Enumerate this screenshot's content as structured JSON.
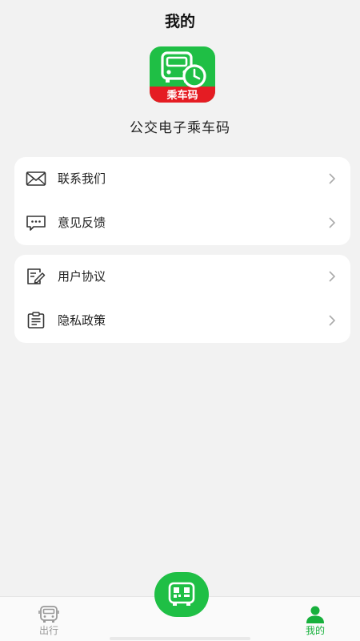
{
  "header": {
    "title": "我的"
  },
  "app": {
    "logo_icon": "bus-clock-logo-icon",
    "logo_text": "乘车码",
    "name": "公交电子乘车码",
    "brand_color": "#1fbf45",
    "logo_banner_color": "#e51c23"
  },
  "menu_groups": [
    {
      "items": [
        {
          "label": "联系我们",
          "icon": "mail-icon"
        },
        {
          "label": "意见反馈",
          "icon": "feedback-icon"
        }
      ]
    },
    {
      "items": [
        {
          "label": "用户协议",
          "icon": "agreement-icon"
        },
        {
          "label": "隐私政策",
          "icon": "privacy-icon"
        }
      ]
    }
  ],
  "tabbar": {
    "items": [
      {
        "label": "出行",
        "icon": "bus-icon",
        "active": false
      },
      {
        "label": "我的",
        "icon": "person-icon",
        "active": true
      }
    ],
    "center_button_icon": "bus-qr-icon"
  }
}
